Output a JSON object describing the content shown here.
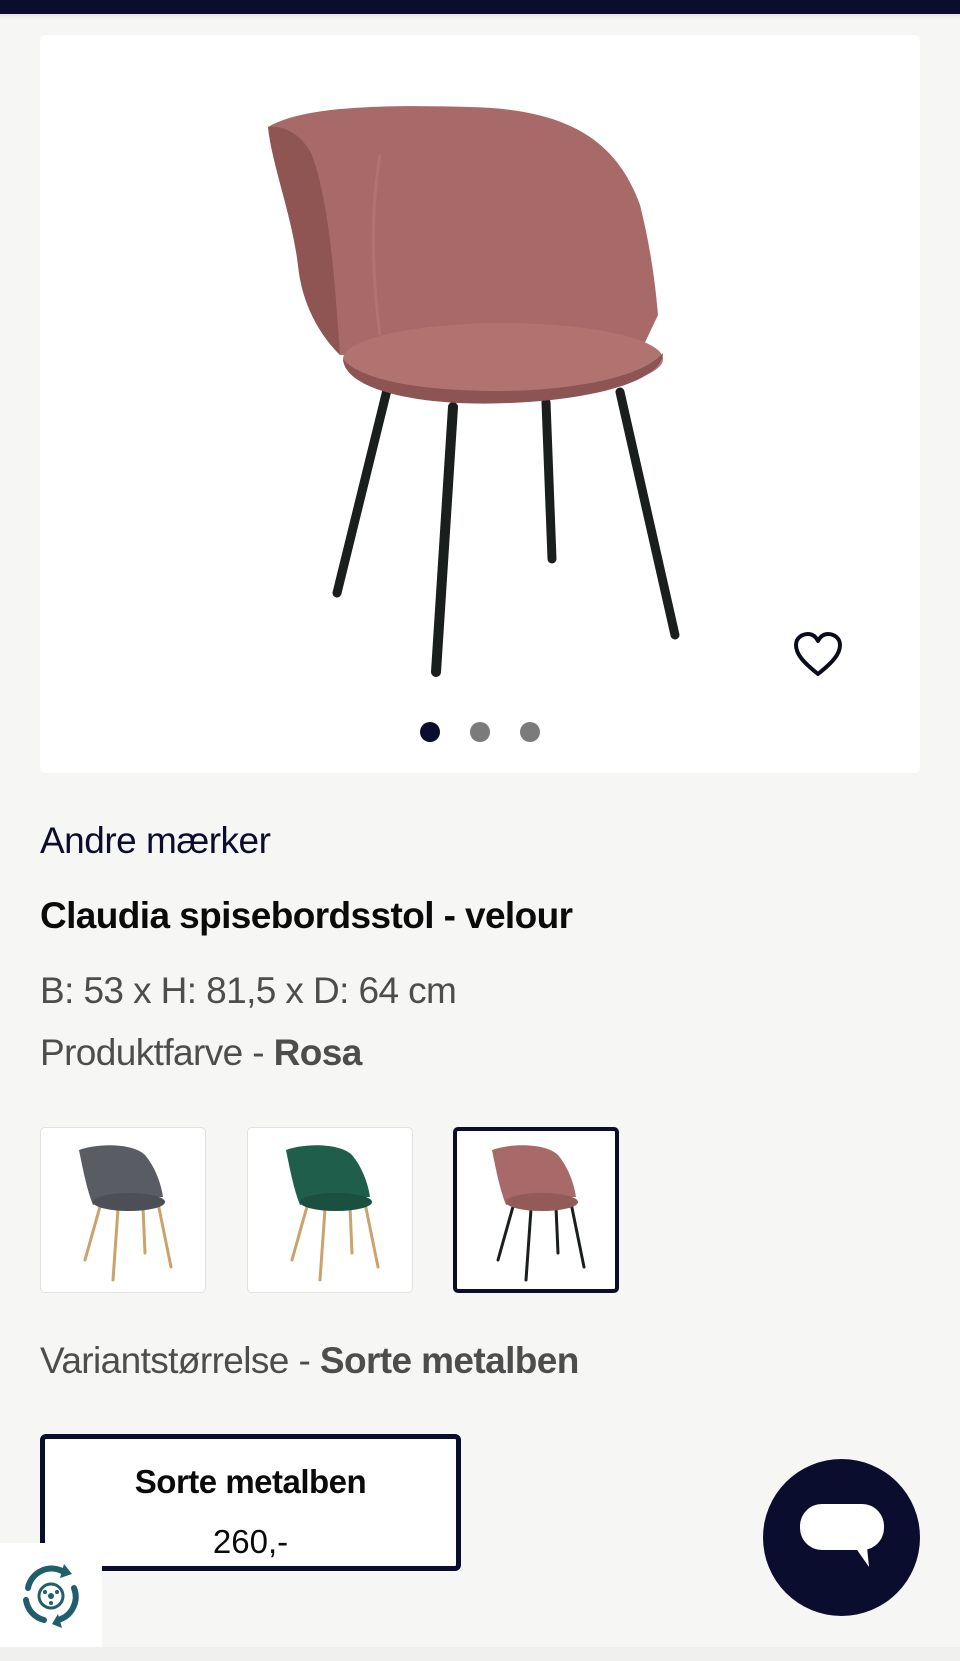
{
  "product": {
    "brand": "Andre mærker",
    "title": "Claudia spisebordsstol - velour",
    "dimensions": "B: 53 x H: 81,5 x D: 64 cm",
    "color_label": "Produktfarve - ",
    "color_value": "Rosa"
  },
  "gallery": {
    "image_count": 3,
    "active_index": 0,
    "favorite_icon": "heart-outline-icon"
  },
  "color_swatches": [
    {
      "name": "grey",
      "seat_color": "#5a5c63",
      "legs_color": "#c9a36b",
      "selected": false
    },
    {
      "name": "green",
      "seat_color": "#1f5e4a",
      "legs_color": "#c9a36b",
      "selected": false
    },
    {
      "name": "rosa",
      "seat_color": "#a86a68",
      "legs_color": "#1a1f1d",
      "selected": true
    }
  ],
  "variant": {
    "label": "Variantstørrelse - ",
    "value": "Sorte metalben",
    "options": [
      {
        "name": "Sorte metalben",
        "price": "260,-"
      }
    ]
  },
  "colors": {
    "navy": "#0b0d2e",
    "chair_pink": "#a86a68",
    "background": "#f6f6f5"
  },
  "icons": {
    "chat": "chat-bubble-icon",
    "recycle": "recycle-icon"
  }
}
